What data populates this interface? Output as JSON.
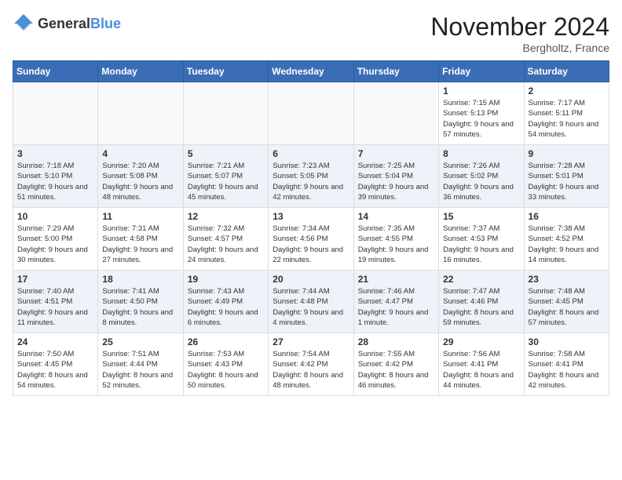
{
  "header": {
    "logo_general": "General",
    "logo_blue": "Blue",
    "month_title": "November 2024",
    "location": "Bergholtz, France"
  },
  "days_of_week": [
    "Sunday",
    "Monday",
    "Tuesday",
    "Wednesday",
    "Thursday",
    "Friday",
    "Saturday"
  ],
  "weeks": [
    [
      {
        "day": "",
        "info": ""
      },
      {
        "day": "",
        "info": ""
      },
      {
        "day": "",
        "info": ""
      },
      {
        "day": "",
        "info": ""
      },
      {
        "day": "",
        "info": ""
      },
      {
        "day": "1",
        "info": "Sunrise: 7:15 AM\nSunset: 5:13 PM\nDaylight: 9 hours and 57 minutes."
      },
      {
        "day": "2",
        "info": "Sunrise: 7:17 AM\nSunset: 5:11 PM\nDaylight: 9 hours and 54 minutes."
      }
    ],
    [
      {
        "day": "3",
        "info": "Sunrise: 7:18 AM\nSunset: 5:10 PM\nDaylight: 9 hours and 51 minutes."
      },
      {
        "day": "4",
        "info": "Sunrise: 7:20 AM\nSunset: 5:08 PM\nDaylight: 9 hours and 48 minutes."
      },
      {
        "day": "5",
        "info": "Sunrise: 7:21 AM\nSunset: 5:07 PM\nDaylight: 9 hours and 45 minutes."
      },
      {
        "day": "6",
        "info": "Sunrise: 7:23 AM\nSunset: 5:05 PM\nDaylight: 9 hours and 42 minutes."
      },
      {
        "day": "7",
        "info": "Sunrise: 7:25 AM\nSunset: 5:04 PM\nDaylight: 9 hours and 39 minutes."
      },
      {
        "day": "8",
        "info": "Sunrise: 7:26 AM\nSunset: 5:02 PM\nDaylight: 9 hours and 36 minutes."
      },
      {
        "day": "9",
        "info": "Sunrise: 7:28 AM\nSunset: 5:01 PM\nDaylight: 9 hours and 33 minutes."
      }
    ],
    [
      {
        "day": "10",
        "info": "Sunrise: 7:29 AM\nSunset: 5:00 PM\nDaylight: 9 hours and 30 minutes."
      },
      {
        "day": "11",
        "info": "Sunrise: 7:31 AM\nSunset: 4:58 PM\nDaylight: 9 hours and 27 minutes."
      },
      {
        "day": "12",
        "info": "Sunrise: 7:32 AM\nSunset: 4:57 PM\nDaylight: 9 hours and 24 minutes."
      },
      {
        "day": "13",
        "info": "Sunrise: 7:34 AM\nSunset: 4:56 PM\nDaylight: 9 hours and 22 minutes."
      },
      {
        "day": "14",
        "info": "Sunrise: 7:35 AM\nSunset: 4:55 PM\nDaylight: 9 hours and 19 minutes."
      },
      {
        "day": "15",
        "info": "Sunrise: 7:37 AM\nSunset: 4:53 PM\nDaylight: 9 hours and 16 minutes."
      },
      {
        "day": "16",
        "info": "Sunrise: 7:38 AM\nSunset: 4:52 PM\nDaylight: 9 hours and 14 minutes."
      }
    ],
    [
      {
        "day": "17",
        "info": "Sunrise: 7:40 AM\nSunset: 4:51 PM\nDaylight: 9 hours and 11 minutes."
      },
      {
        "day": "18",
        "info": "Sunrise: 7:41 AM\nSunset: 4:50 PM\nDaylight: 9 hours and 8 minutes."
      },
      {
        "day": "19",
        "info": "Sunrise: 7:43 AM\nSunset: 4:49 PM\nDaylight: 9 hours and 6 minutes."
      },
      {
        "day": "20",
        "info": "Sunrise: 7:44 AM\nSunset: 4:48 PM\nDaylight: 9 hours and 4 minutes."
      },
      {
        "day": "21",
        "info": "Sunrise: 7:46 AM\nSunset: 4:47 PM\nDaylight: 9 hours and 1 minute."
      },
      {
        "day": "22",
        "info": "Sunrise: 7:47 AM\nSunset: 4:46 PM\nDaylight: 8 hours and 59 minutes."
      },
      {
        "day": "23",
        "info": "Sunrise: 7:48 AM\nSunset: 4:45 PM\nDaylight: 8 hours and 57 minutes."
      }
    ],
    [
      {
        "day": "24",
        "info": "Sunrise: 7:50 AM\nSunset: 4:45 PM\nDaylight: 8 hours and 54 minutes."
      },
      {
        "day": "25",
        "info": "Sunrise: 7:51 AM\nSunset: 4:44 PM\nDaylight: 8 hours and 52 minutes."
      },
      {
        "day": "26",
        "info": "Sunrise: 7:53 AM\nSunset: 4:43 PM\nDaylight: 8 hours and 50 minutes."
      },
      {
        "day": "27",
        "info": "Sunrise: 7:54 AM\nSunset: 4:42 PM\nDaylight: 8 hours and 48 minutes."
      },
      {
        "day": "28",
        "info": "Sunrise: 7:55 AM\nSunset: 4:42 PM\nDaylight: 8 hours and 46 minutes."
      },
      {
        "day": "29",
        "info": "Sunrise: 7:56 AM\nSunset: 4:41 PM\nDaylight: 8 hours and 44 minutes."
      },
      {
        "day": "30",
        "info": "Sunrise: 7:58 AM\nSunset: 4:41 PM\nDaylight: 8 hours and 42 minutes."
      }
    ]
  ]
}
